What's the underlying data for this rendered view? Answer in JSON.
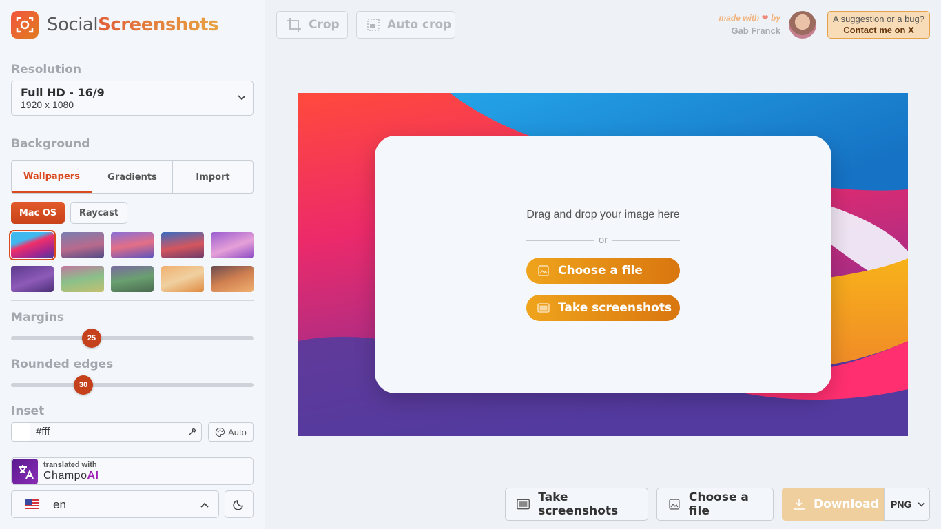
{
  "brand": {
    "name_part1": "Social",
    "name_part2": "Screenshots"
  },
  "sidebar": {
    "resolution": {
      "label": "Resolution",
      "selected_title": "Full HD - 16/9",
      "selected_size": "1920 x 1080"
    },
    "background": {
      "label": "Background",
      "tabs": [
        "Wallpapers",
        "Gradients",
        "Import"
      ],
      "active_tab": "Wallpapers",
      "chips": [
        "Mac OS",
        "Raycast"
      ],
      "active_chip": "Mac OS",
      "wallpapers": [
        "big-sur",
        "monterey-dark",
        "monterey-blue",
        "monterey-red",
        "purple-soft",
        "purple-dark",
        "sonoma-green",
        "sonoma-green-dark",
        "ventura-orange",
        "ventura-dark"
      ]
    },
    "margins": {
      "label": "Margins",
      "value": "25",
      "fraction": 0.33
    },
    "rounded_edges": {
      "label": "Rounded edges",
      "value": "30",
      "fraction": 0.3
    },
    "inset": {
      "label": "Inset",
      "value": "#fff",
      "auto_label": "Auto"
    },
    "champo": {
      "small": "translated with",
      "big_part1": "Champo",
      "big_part2": "AI"
    },
    "language": {
      "value": "en"
    }
  },
  "topbar": {
    "crop_label": "Crop",
    "autocrop_label": "Auto crop",
    "made_with": "made with",
    "by": "by",
    "author": "Gab Franck",
    "contact_line1": "A suggestion or a bug?",
    "contact_line2": "Contact me on X"
  },
  "canvas": {
    "drop_text": "Drag and drop your image here",
    "or": "or",
    "choose_file": "Choose a file",
    "take_screenshots": "Take screenshots"
  },
  "bottombar": {
    "take_screenshots": "Take screenshots",
    "choose_file": "Choose a file",
    "download": "Download",
    "format": "PNG"
  },
  "colors": {
    "accent": "#d94a1e",
    "orange": "#efa41c"
  }
}
